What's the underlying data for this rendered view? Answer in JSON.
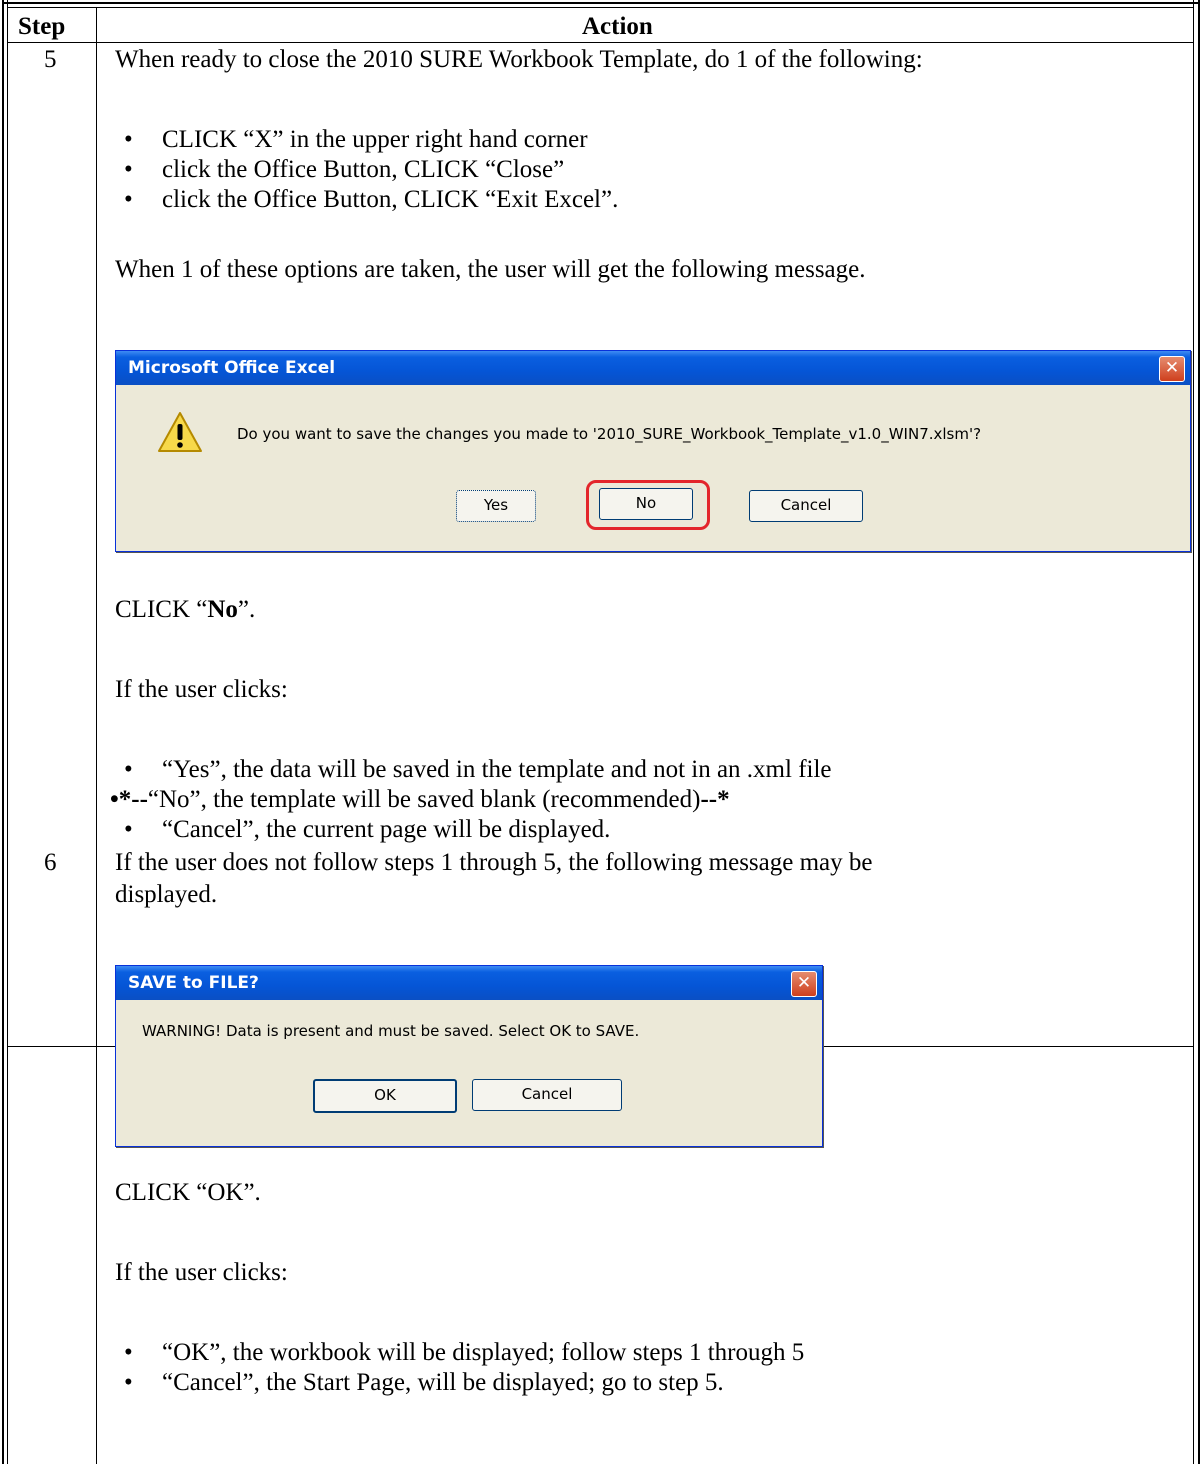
{
  "table": {
    "header_step": "Step",
    "header_action": "Action"
  },
  "step5": {
    "number": "5",
    "intro": "When ready to close the 2010 SURE Workbook Template, do 1 of the following:",
    "options": [
      "CLICK “X” in the upper right hand corner",
      "click the Office Button, CLICK “Close”",
      "click the Office Button, CLICK “Exit Excel”."
    ],
    "after_options": "When 1 of these options are taken, the user will get the following message.",
    "dialog": {
      "title": "Microsoft Office Excel",
      "message": "Do you want to save the changes you made to '2010_SURE_Workbook_Template_v1.0_WIN7.xlsm'?",
      "buttons": [
        "Yes",
        "No",
        "Cancel"
      ],
      "highlighted_button": "No",
      "close_glyph": "✕",
      "icon": "warning-icon"
    },
    "instruction_prefix": "CLICK “",
    "instruction_bold": "No",
    "instruction_suffix": "”.",
    "if_clicks": "If the user clicks:",
    "outcome_yes": "“Yes”, the data will be saved in the template and not in an .xml file",
    "outcome_no_mark_start": "•*--",
    "outcome_no_text": "“No”, the template will be saved blank (recommended)",
    "outcome_no_mark_end": "--*",
    "outcome_cancel": "“Cancel”, the current page will be displayed."
  },
  "step6": {
    "number": "6",
    "intro_line1": "If the user does not follow steps 1 through 5, the following message may be",
    "intro_line2": "displayed.",
    "dialog": {
      "title": "SAVE to FILE?",
      "message": "WARNING!  Data is present and must be saved.  Select OK to SAVE.",
      "buttons": [
        "OK",
        "Cancel"
      ],
      "close_glyph": "✕"
    },
    "instruction": "CLICK “OK”.",
    "if_clicks": "If the user clicks:",
    "outcomes": [
      "“OK”, the workbook will be displayed; follow steps 1 through 5",
      "“Cancel”, the Start Page, will be displayed; go to step 5."
    ]
  },
  "bullet": "•",
  "colors": {
    "title_bar": "#0555d6",
    "dialog_bg": "#ece9d8",
    "close_button": "#cf3f1d",
    "highlight_ring": "#e3262b"
  }
}
